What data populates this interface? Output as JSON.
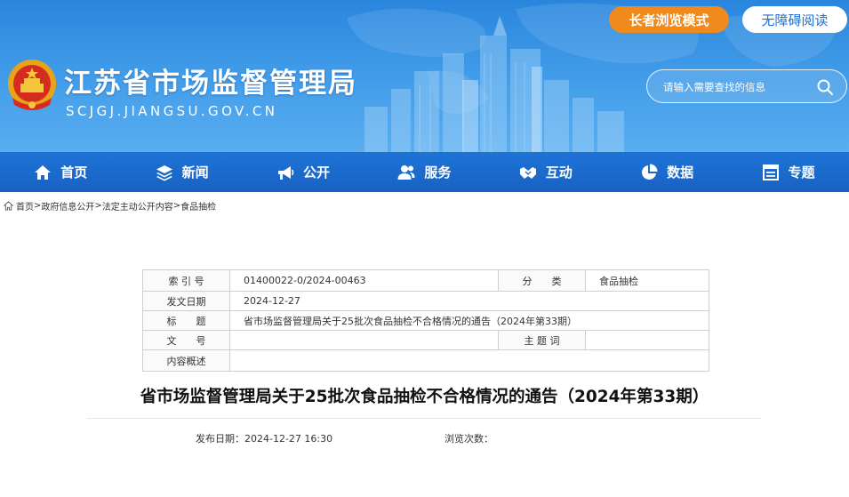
{
  "header": {
    "site_name": "江苏省市场监督管理局",
    "site_domain": "SCJGJ.JIANGSU.GOV.CN",
    "elder_mode_label": "长者浏览模式",
    "accessibility_label": "无障碍阅读",
    "search_placeholder": "请输入需要查找的信息",
    "colors": {
      "banner": "#3f9ae8",
      "nav": "#1e73d6",
      "elder_button": "#f08a1c"
    }
  },
  "nav": {
    "items": [
      {
        "label": "首页",
        "icon": "home-icon"
      },
      {
        "label": "新闻",
        "icon": "layers-icon"
      },
      {
        "label": "公开",
        "icon": "megaphone-icon"
      },
      {
        "label": "服务",
        "icon": "user-group-icon"
      },
      {
        "label": "互动",
        "icon": "handshake-icon"
      },
      {
        "label": "数据",
        "icon": "pie-chart-icon"
      },
      {
        "label": "专题",
        "icon": "window-icon"
      }
    ]
  },
  "breadcrumb": {
    "items": [
      "首页",
      "政府信息公开",
      "法定主动公开内容",
      "食品抽检"
    ],
    "separator": ">"
  },
  "info_table": {
    "index_label": "索 引 号",
    "index_value": "01400022-0/2024-00463",
    "category_label": "分　　类",
    "category_value": "食品抽检",
    "date_label": "发文日期",
    "date_value": "2024-12-27",
    "title_label": "标　　题",
    "title_value": "省市场监督管理局关于25批次食品抽检不合格情况的通告（2024年第33期）",
    "doc_no_label": "文　　号",
    "doc_no_value": "",
    "keywords_label": "主 题 词",
    "keywords_value": "",
    "summary_label": "内容概述",
    "summary_value": ""
  },
  "article": {
    "title": "省市场监督管理局关于25批次食品抽检不合格情况的通告（2024年第33期）",
    "publish_date": "发布日期：2024-12-27 16:30",
    "views_label": "浏览次数："
  }
}
